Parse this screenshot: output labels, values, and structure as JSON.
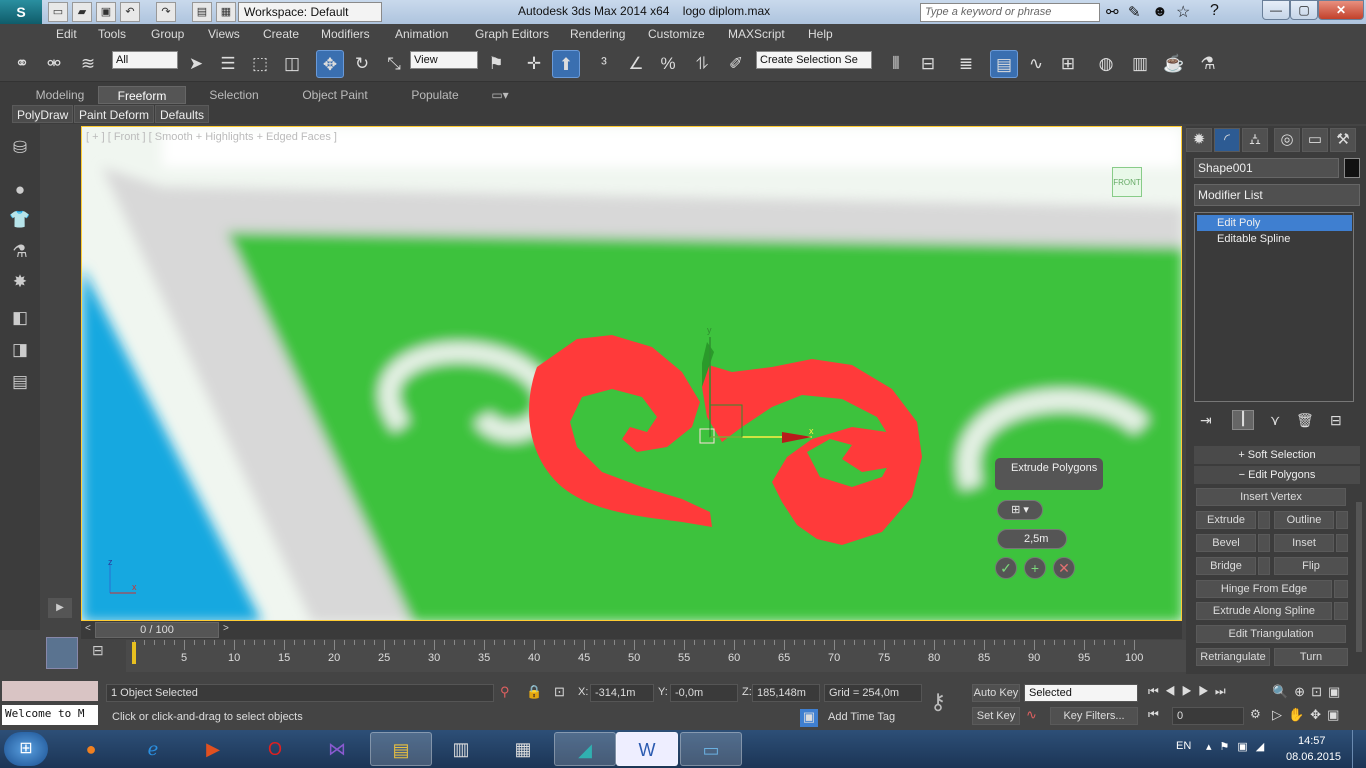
{
  "window": {
    "title": "Autodesk 3ds Max  2014 x64",
    "file": "logo diplom.max",
    "workspace": "Workspace: Default",
    "search_placeholder": "Type a keyword or phrase",
    "minimize": "—",
    "maximize": "▢",
    "close": "✕"
  },
  "menu": [
    "Edit",
    "Tools",
    "Group",
    "Views",
    "Create",
    "Modifiers",
    "Animation",
    "Graph Editors",
    "Rendering",
    "Customize",
    "MAXScript",
    "Help"
  ],
  "toolbar": {
    "selection_filter": "All",
    "ref_coord": "View",
    "named_selection": "Create Selection Se"
  },
  "ribbon": {
    "tabs": [
      "Modeling",
      "Freeform",
      "Selection",
      "Object Paint",
      "Populate"
    ],
    "active_tab": "Freeform",
    "subtabs": [
      "PolyDraw",
      "Paint Deform",
      "Defaults"
    ]
  },
  "viewport": {
    "label": "[ + ] [ Front ] [ Smooth + Highlights + Edged Faces ]",
    "viewcube": "FRONT",
    "axis_x": "x",
    "axis_y": "y",
    "axis_z": "z",
    "axis_gx": "x"
  },
  "caddy": {
    "title": "Extrude Polygons",
    "amount": "2,5m",
    "ok": "✓",
    "apply": "+",
    "cancel": "✕"
  },
  "command_panel": {
    "object_name": "Shape001",
    "modifier_list": "Modifier List",
    "stack": [
      {
        "label": "Edit Poly"
      },
      {
        "label": "Editable Spline"
      }
    ],
    "rollouts": {
      "soft_selection": "Soft Selection",
      "edit_polygons": "Edit Polygons"
    },
    "buttons": {
      "insert_vertex": "Insert Vertex",
      "extrude": "Extrude",
      "outline": "Outline",
      "bevel": "Bevel",
      "inset": "Inset",
      "bridge": "Bridge",
      "flip": "Flip",
      "hinge": "Hinge From Edge",
      "extrude_spline": "Extrude Along Spline",
      "edit_tri": "Edit Triangulation",
      "retriangulate": "Retriangulate",
      "turn": "Turn"
    }
  },
  "timeline": {
    "frame": "0 / 100",
    "ticks": [
      "0",
      "5",
      "10",
      "15",
      "20",
      "25",
      "30",
      "35",
      "40",
      "45",
      "50",
      "55",
      "60",
      "65",
      "70",
      "75",
      "80",
      "85",
      "90",
      "95",
      "100"
    ]
  },
  "status": {
    "maxscript": "Welcome to M",
    "selected": "1 Object Selected",
    "prompt": "Click or click-and-drag to select objects",
    "x": "-314,1m",
    "y": "-0,0m",
    "z": "185,148m",
    "grid": "Grid = 254,0m",
    "add_time_tag": "Add Time Tag",
    "auto_key": "Auto Key",
    "set_key": "Set Key",
    "key_filters": "Key Filters...",
    "key_mode": "Selected",
    "current_frame": "0"
  },
  "taskbar": {
    "lang": "EN",
    "time": "14:57",
    "date": "08.06.2015"
  },
  "colors": {
    "viewport_green": "#3cc23c",
    "logo_red": "#ff3a3a",
    "accent": "#3f7fd0"
  }
}
